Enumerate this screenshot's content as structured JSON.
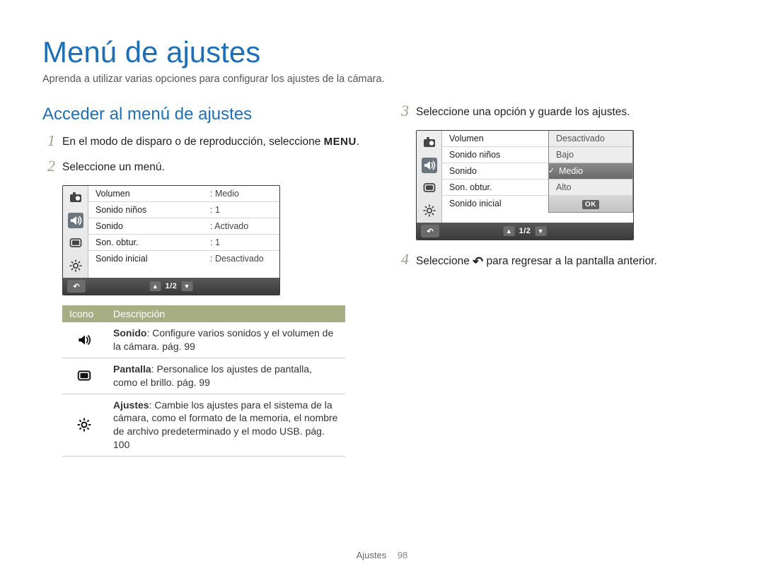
{
  "title": "Menú de ajustes",
  "intro": "Aprenda a utilizar varias opciones para configurar los ajustes de la cámara.",
  "section_heading": "Acceder al menú de ajustes",
  "steps": [
    {
      "num": "1",
      "text_before": "En el modo de disparo o de reproducción, seleccione ",
      "glyph": "MENU",
      "text_after": "."
    },
    {
      "num": "2",
      "text": "Seleccione un menú."
    },
    {
      "num": "3",
      "text": "Seleccione una opción y guarde los ajustes."
    },
    {
      "num": "4",
      "text_before": "Seleccione ",
      "glyph": "↶",
      "text_after": " para regresar a la pantalla anterior."
    }
  ],
  "lcd1": {
    "rows": [
      {
        "label": "Volumen",
        "value": ": Medio"
      },
      {
        "label": "Sonido niños",
        "value": ": 1"
      },
      {
        "label": "Sonido",
        "value": ": Activado"
      },
      {
        "label": "Son. obtur.",
        "value": ": 1"
      },
      {
        "label": "Sonido inicial",
        "value": ": Desactivado"
      }
    ],
    "back_glyph": "↶",
    "page_indicator": "1/2"
  },
  "lcd2": {
    "rows": [
      {
        "label": "Volumen"
      },
      {
        "label": "Sonido niños"
      },
      {
        "label": "Sonido"
      },
      {
        "label": "Son. obtur."
      },
      {
        "label": "Sonido inicial"
      }
    ],
    "options": [
      {
        "label": "Desactivado",
        "selected": false
      },
      {
        "label": "Bajo",
        "selected": false
      },
      {
        "label": "Medio",
        "selected": true
      },
      {
        "label": "Alto",
        "selected": false
      }
    ],
    "ok_label": "OK",
    "back_glyph": "↶",
    "page_indicator": "1/2"
  },
  "legend": {
    "headers": {
      "icon": "Icono",
      "desc": "Descripción"
    },
    "rows": [
      {
        "icon": "sound",
        "title": "Sonido",
        "rest": ": Configure varios sonidos y el volumen de la cámara. pág. 99"
      },
      {
        "icon": "display",
        "title": "Pantalla",
        "rest": ": Personalice los ajustes de pantalla, como el brillo. pág. 99"
      },
      {
        "icon": "gear",
        "title": "Ajustes",
        "rest": ": Cambie los ajustes para el sistema de la cámara, como el formato de la memoria, el nombre de archivo predeterminado y el modo USB. pág. 100"
      }
    ]
  },
  "footer": {
    "section": "Ajustes",
    "page": "98"
  }
}
